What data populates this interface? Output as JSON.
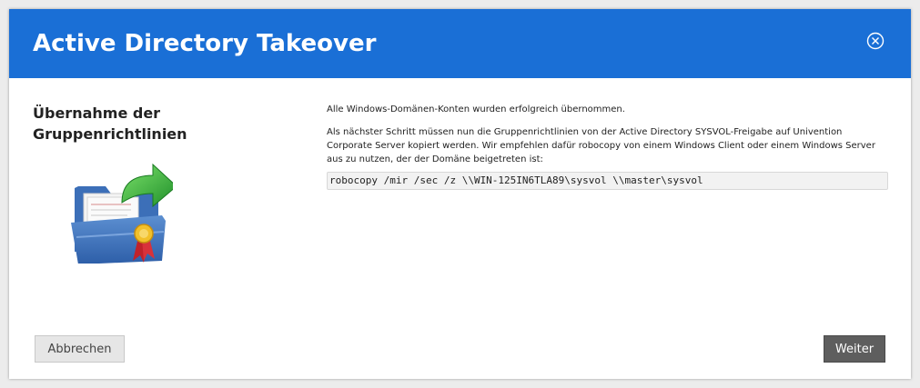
{
  "dialog": {
    "title": "Active Directory Takeover",
    "close_icon": "close-circle-icon",
    "accent_color": "#1a6fd6"
  },
  "sidebar": {
    "heading": "Übernahme der Gruppenrichtlinien",
    "illustration_icon": "folder-with-arrow-and-certificate-icon"
  },
  "main": {
    "message_success": "Alle Windows-Domänen-Konten wurden erfolgreich übernommen.",
    "message_next_step": "Als nächster Schritt müssen nun die Gruppenrichtlinien von der Active Directory SYSVOL-Freigabe auf Univention Corporate Server kopiert werden. Wir empfehlen dafür robocopy von einem Windows Client oder einem Windows Server aus zu nutzen, der der Domäne beigetreten ist:",
    "command": "robocopy /mir /sec /z \\\\WIN-125IN6TLA89\\sysvol \\\\master\\sysvol"
  },
  "footer": {
    "cancel_label": "Abbrechen",
    "next_label": "Weiter"
  }
}
